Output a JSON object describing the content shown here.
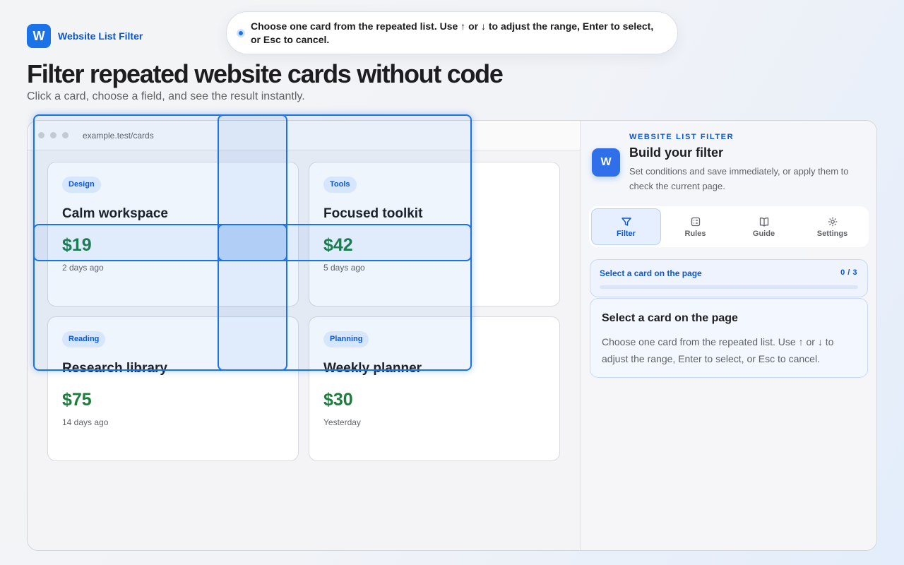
{
  "brand": {
    "logo_letter": "W",
    "name": "Website List Filter"
  },
  "toast": {
    "message": "Choose one card from the repeated list. Use ↑ or ↓ to adjust the range, Enter to select, or Esc to cancel."
  },
  "hero": {
    "title": "Filter repeated website cards without code",
    "subtitle": "Click a card, choose a field, and see the result instantly."
  },
  "browser": {
    "url": "example.test/cards"
  },
  "cards": [
    {
      "tag": "Design",
      "title": "Calm workspace",
      "price": "$19",
      "date": "2 days ago"
    },
    {
      "tag": "Tools",
      "title": "Focused toolkit",
      "price": "$42",
      "date": "5 days ago"
    },
    {
      "tag": "Reading",
      "title": "Research library",
      "price": "$75",
      "date": "14 days ago"
    },
    {
      "tag": "Planning",
      "title": "Weekly planner",
      "price": "$30",
      "date": "Yesterday"
    }
  ],
  "panel": {
    "logo_letter": "W",
    "eyebrow": "WEBSITE LIST FILTER",
    "title": "Build your filter",
    "description": "Set conditions and save immediately, or apply them to check the current page.",
    "tabs": [
      {
        "label": "Filter",
        "icon": "funnel-icon",
        "active": true
      },
      {
        "label": "Rules",
        "icon": "checklist-icon",
        "active": false
      },
      {
        "label": "Guide",
        "icon": "book-icon",
        "active": false
      },
      {
        "label": "Settings",
        "icon": "gear-icon",
        "active": false
      }
    ],
    "progress": {
      "label": "Select a card on the page",
      "count": "0 / 3",
      "fraction": 0
    },
    "step": {
      "title": "Select a card on the page",
      "body": "Choose one card from the repeated list. Use ↑ or ↓ to adjust the range, Enter to select, or Esc to cancel."
    }
  },
  "colors": {
    "accent": "#1a73e8",
    "brand": "#0b57d0",
    "price": "#1a7f3c"
  }
}
